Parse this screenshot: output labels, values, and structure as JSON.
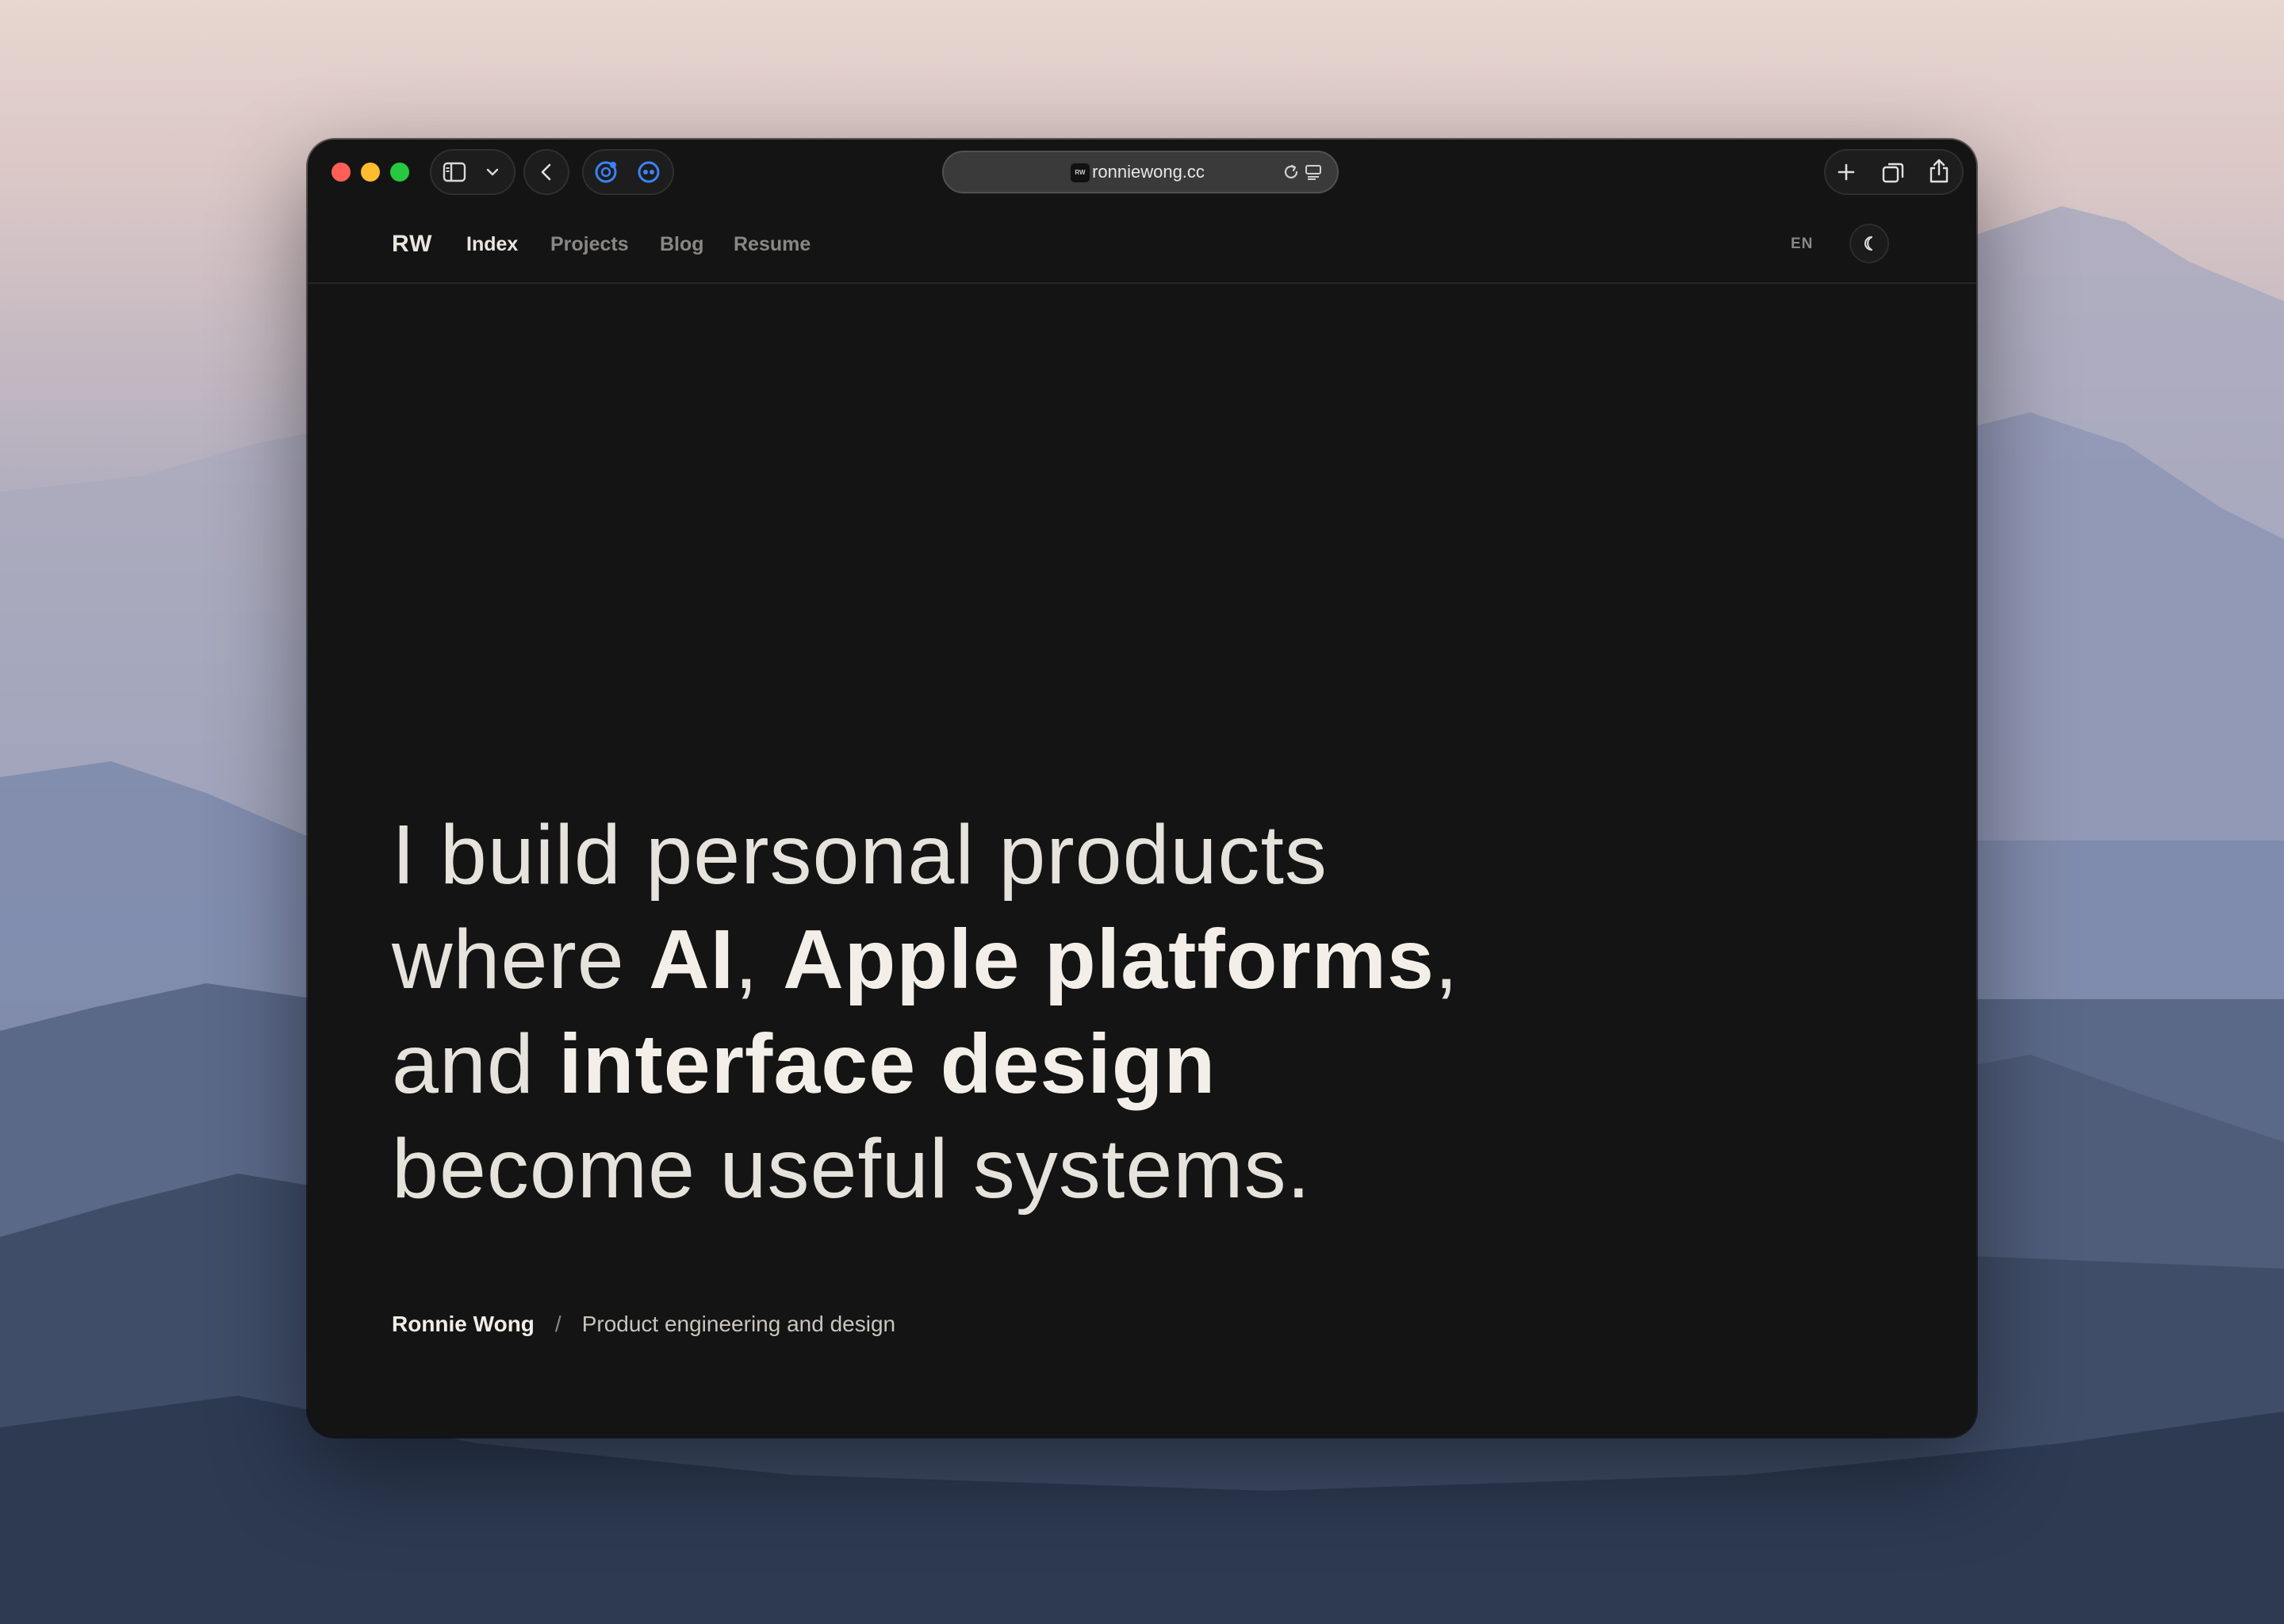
{
  "browser": {
    "url": "ronniewong.cc",
    "favicon_text": "RW"
  },
  "site": {
    "brand": "RW",
    "nav": [
      {
        "label": "Index",
        "active": true
      },
      {
        "label": "Projects",
        "active": false
      },
      {
        "label": "Blog",
        "active": false
      },
      {
        "label": "Resume",
        "active": false
      }
    ],
    "language": "EN",
    "theme_icon": "moon-icon"
  },
  "hero": {
    "line1": "I build personal products",
    "line2_pre": "where ",
    "line2_b1": "AI",
    "line2_mid": ", ",
    "line2_b2": "Apple platforms",
    "line2_post": ",",
    "line3_pre": "and ",
    "line3_b": "interface design",
    "line4": "become useful systems."
  },
  "byline": {
    "name": "Ronnie Wong",
    "separator": "/",
    "role": "Product engineering and design"
  },
  "colors": {
    "page_bg": "#141414",
    "text_primary": "#f3efe8",
    "text_muted": "#8a8782",
    "accent_blue": "#3b82f6",
    "traffic_red": "#ff5f57",
    "traffic_yellow": "#febc2e",
    "traffic_green": "#28c840"
  }
}
